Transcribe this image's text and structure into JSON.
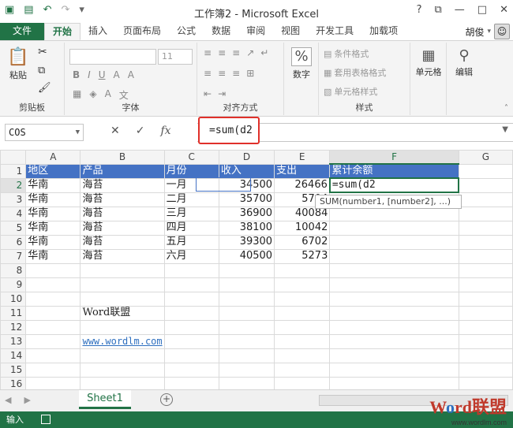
{
  "window": {
    "title": "工作簿2 - Microsoft Excel",
    "help": "?",
    "restore": "⧉",
    "minimize": "—",
    "maximize": "□",
    "close": "✕"
  },
  "ribbon_tabs": [
    "文件",
    "开始",
    "插入",
    "页面布局",
    "公式",
    "数据",
    "审阅",
    "视图",
    "开发工具",
    "加载项"
  ],
  "user": "胡俊",
  "ribbon": {
    "clipboard": {
      "label": "剪贴板",
      "paste": "粘贴"
    },
    "font": {
      "label": "字体",
      "size": "11"
    },
    "alignment": {
      "label": "对齐方式"
    },
    "number": {
      "label": "数字",
      "button": "数字",
      "symbol": "%"
    },
    "styles": {
      "label": "样式",
      "cond": "条件格式",
      "table": "套用表格格式",
      "cell": "单元格样式"
    },
    "cells": {
      "button": "单元格"
    },
    "editing": {
      "button": "编辑"
    }
  },
  "formula_bar": {
    "name_box": "COS",
    "cancel": "✕",
    "enter": "✓",
    "fx": "fx",
    "formula": "=sum(d2"
  },
  "columns": [
    "A",
    "B",
    "C",
    "D",
    "E",
    "F",
    "G"
  ],
  "rows": [
    {
      "n": "1",
      "cells": [
        "地区",
        "产品",
        "月份",
        "收入",
        "支出",
        "累计余额",
        ""
      ]
    },
    {
      "n": "2",
      "cells": [
        "华南",
        "海苔",
        "一月",
        "34500",
        "26466",
        "=sum(d2",
        ""
      ]
    },
    {
      "n": "3",
      "cells": [
        "华南",
        "海苔",
        "二月",
        "35700",
        "5704",
        "",
        ""
      ]
    },
    {
      "n": "4",
      "cells": [
        "华南",
        "海苔",
        "三月",
        "36900",
        "40084",
        "",
        ""
      ]
    },
    {
      "n": "5",
      "cells": [
        "华南",
        "海苔",
        "四月",
        "38100",
        "10042",
        "",
        ""
      ]
    },
    {
      "n": "6",
      "cells": [
        "华南",
        "海苔",
        "五月",
        "39300",
        "6702",
        "",
        ""
      ]
    },
    {
      "n": "7",
      "cells": [
        "华南",
        "海苔",
        "六月",
        "40500",
        "5273",
        "",
        ""
      ]
    },
    {
      "n": "8",
      "cells": [
        "",
        "",
        "",
        "",
        "",
        "",
        ""
      ]
    },
    {
      "n": "9",
      "cells": [
        "",
        "",
        "",
        "",
        "",
        "",
        ""
      ]
    },
    {
      "n": "10",
      "cells": [
        "",
        "",
        "",
        "",
        "",
        "",
        ""
      ]
    },
    {
      "n": "11",
      "cells": [
        "",
        "Word联盟",
        "",
        "",
        "",
        "",
        ""
      ]
    },
    {
      "n": "12",
      "cells": [
        "",
        "",
        "",
        "",
        "",
        "",
        ""
      ]
    },
    {
      "n": "13",
      "cells": [
        "",
        "www.wordlm.com",
        "",
        "",
        "",
        "",
        ""
      ]
    },
    {
      "n": "14",
      "cells": [
        "",
        "",
        "",
        "",
        "",
        "",
        ""
      ]
    },
    {
      "n": "15",
      "cells": [
        "",
        "",
        "",
        "",
        "",
        "",
        ""
      ]
    },
    {
      "n": "16",
      "cells": [
        "",
        "",
        "",
        "",
        "",
        "",
        ""
      ]
    },
    {
      "n": "17",
      "cells": [
        "",
        "",
        "",
        "",
        "",
        "",
        ""
      ]
    }
  ],
  "function_tip": "SUM(number1, [number2], ...)",
  "sheet_tabs": [
    "Sheet1"
  ],
  "status": "输入",
  "watermark": {
    "brand_a": "W",
    "brand_b": "o",
    "brand_c": "rd联盟",
    "url": "www.wordlm.com"
  },
  "colors": {
    "excel_green": "#217346",
    "header_blue": "#4472c4",
    "highlight_red": "#e0302a"
  }
}
